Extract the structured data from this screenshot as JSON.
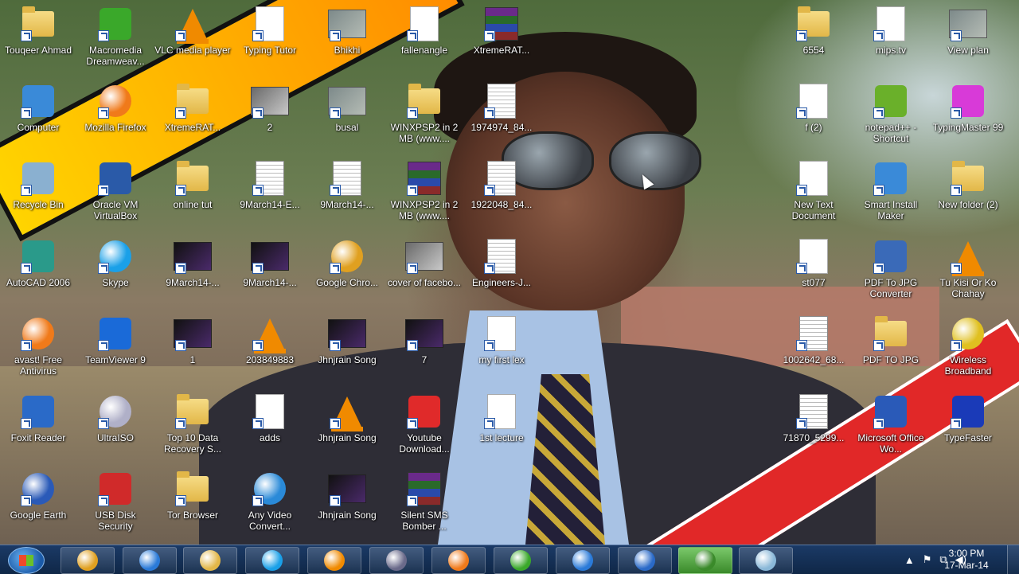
{
  "desktop": {
    "icons": [
      {
        "label": "Touqeer Ahmad",
        "icon": "user-folder-icon",
        "type": "folder",
        "x": 0,
        "y": 0
      },
      {
        "label": "Macromedia Dreamweav...",
        "icon": "dreamweaver-icon",
        "type": "app",
        "color": "#3aa82a"
      },
      {
        "label": "VLC media player",
        "icon": "vlc-icon",
        "type": "cone"
      },
      {
        "label": "Typing Tutor",
        "icon": "folder-icon",
        "type": "doc"
      },
      {
        "label": "Bhikhi",
        "icon": "image-thumbnail-icon",
        "type": "map"
      },
      {
        "label": "fallenangle",
        "icon": "html-file-icon",
        "type": "doc"
      },
      {
        "label": "XtremeRAT...",
        "icon": "winrar-icon",
        "type": "winrar"
      },
      {
        "label": "Computer",
        "icon": "computer-icon",
        "type": "app",
        "color": "#3a8ad8"
      },
      {
        "label": "Mozilla Firefox",
        "icon": "firefox-icon",
        "type": "round",
        "color": "#f07a1a"
      },
      {
        "label": "XtremeRAT...",
        "icon": "folder-icon",
        "type": "folder"
      },
      {
        "label": "2",
        "icon": "video-thumbnail-icon",
        "type": "thumb"
      },
      {
        "label": "busal",
        "icon": "image-thumbnail-icon",
        "type": "map"
      },
      {
        "label": "WINXPSP2 in 2 MB (www....",
        "icon": "folder-icon",
        "type": "folder"
      },
      {
        "label": "1974974_84...",
        "icon": "document-thumbnail-icon",
        "type": "docl"
      },
      {
        "label": "Recycle Bin",
        "icon": "recycle-bin-icon",
        "type": "app",
        "color": "#8ab0d0"
      },
      {
        "label": "Oracle VM VirtualBox",
        "icon": "virtualbox-icon",
        "type": "app",
        "color": "#2a5aa8"
      },
      {
        "label": "online tut",
        "icon": "folder-icon",
        "type": "folder"
      },
      {
        "label": "9March14-E...",
        "icon": "document-thumbnail-icon",
        "type": "docl"
      },
      {
        "label": "9March14-...",
        "icon": "document-thumbnail-icon",
        "type": "docl"
      },
      {
        "label": "WINXPSP2 in 2 MB (www....",
        "icon": "winrar-icon",
        "type": "winrar"
      },
      {
        "label": "1922048_84...",
        "icon": "document-thumbnail-icon",
        "type": "docl"
      },
      {
        "label": "AutoCAD 2006",
        "icon": "autocad-icon",
        "type": "app",
        "color": "#2a9a8a"
      },
      {
        "label": "Skype",
        "icon": "skype-icon",
        "type": "round",
        "color": "#1aa0e8"
      },
      {
        "label": "9March14-...",
        "icon": "document-thumbnail-icon",
        "type": "thumbdark"
      },
      {
        "label": "9March14-...",
        "icon": "document-thumbnail-icon",
        "type": "thumbdark"
      },
      {
        "label": "Google Chro...",
        "icon": "chrome-icon",
        "type": "round",
        "color": "#e0a020"
      },
      {
        "label": "cover of facebo...",
        "icon": "image-thumbnail-icon",
        "type": "thumb"
      },
      {
        "label": "Engineers-J...",
        "icon": "document-thumbnail-icon",
        "type": "docl"
      },
      {
        "label": "avast! Free Antivirus",
        "icon": "avast-icon",
        "type": "round",
        "color": "#f07a1a"
      },
      {
        "label": "TeamViewer 9",
        "icon": "teamviewer-icon",
        "type": "app",
        "color": "#1a6ad8"
      },
      {
        "label": "1",
        "icon": "video-thumbnail-icon",
        "type": "thumbdark"
      },
      {
        "label": "203849883",
        "icon": "vlc-icon",
        "type": "cone"
      },
      {
        "label": "Jhnjrain Song",
        "icon": "video-thumbnail-icon",
        "type": "thumbdark"
      },
      {
        "label": "7",
        "icon": "image-thumbnail-icon",
        "type": "thumbdark"
      },
      {
        "label": "my first lex",
        "icon": "firefox-html-icon",
        "type": "doc"
      },
      {
        "label": "Foxit Reader",
        "icon": "foxit-icon",
        "type": "app",
        "color": "#2a6ac8"
      },
      {
        "label": "UltraISO",
        "icon": "ultraiso-icon",
        "type": "round",
        "color": "#b0b0c8"
      },
      {
        "label": "Top 10 Data Recovery S...",
        "icon": "folder-icon",
        "type": "folder"
      },
      {
        "label": "adds",
        "icon": "blank-file-icon",
        "type": "doc"
      },
      {
        "label": "Jhnjrain Song",
        "icon": "vlc-icon",
        "type": "cone"
      },
      {
        "label": "Youtube Download...",
        "icon": "youtube-downloader-icon",
        "type": "app",
        "color": "#e02a2a"
      },
      {
        "label": "1st lecture",
        "icon": "firefox-html-icon",
        "type": "doc"
      },
      {
        "label": "Google Earth",
        "icon": "google-earth-icon",
        "type": "round",
        "color": "#2a5ab8"
      },
      {
        "label": "USB Disk Security",
        "icon": "usb-disk-security-icon",
        "type": "app",
        "color": "#d02a2a"
      },
      {
        "label": "Tor Browser",
        "icon": "folder-icon",
        "type": "folder"
      },
      {
        "label": "Any Video Convert...",
        "icon": "video-converter-icon",
        "type": "round",
        "color": "#2a8ad8"
      },
      {
        "label": "Jhnjrain Song",
        "icon": "video-thumbnail-icon",
        "type": "thumbdark"
      },
      {
        "label": "Silent SMS Bomber ...",
        "icon": "winrar-icon",
        "type": "winrar"
      },
      {
        "label": "6554",
        "icon": "folder-icon",
        "type": "folder"
      },
      {
        "label": "mips.tv",
        "icon": "blank-file-icon",
        "type": "doc"
      },
      {
        "label": "View plan",
        "icon": "image-thumbnail-icon",
        "type": "map"
      },
      {
        "label": "f (2)",
        "icon": "image-thumbnail-icon",
        "type": "doc"
      },
      {
        "label": "notepad++ - Shortcut",
        "icon": "notepadpp-icon",
        "type": "app",
        "color": "#6ab02a"
      },
      {
        "label": "TypingMaster 99",
        "icon": "typingmaster-icon",
        "type": "app",
        "color": "#d83ad8"
      },
      {
        "label": "New Text Document",
        "icon": "text-file-icon",
        "type": "doc"
      },
      {
        "label": "Smart Install Maker",
        "icon": "smart-install-icon",
        "type": "app",
        "color": "#3a8ad8"
      },
      {
        "label": "New folder (2)",
        "icon": "folder-icon",
        "type": "folder"
      },
      {
        "label": "st077",
        "icon": "blank-file-icon",
        "type": "doc"
      },
      {
        "label": "PDF To JPG Converter",
        "icon": "pdf-to-jpg-icon",
        "type": "app",
        "color": "#3a6ab8"
      },
      {
        "label": "Tu Kisi Or Ko Chahay",
        "icon": "vlc-icon",
        "type": "cone"
      },
      {
        "label": "1002642_68...",
        "icon": "spreadsheet-thumbnail-icon",
        "type": "docl"
      },
      {
        "label": "PDF TO JPG",
        "icon": "folder-icon",
        "type": "folder"
      },
      {
        "label": "Wireless Broadband",
        "icon": "worldcall-icon",
        "type": "round",
        "color": "#e0c020"
      },
      {
        "label": "71870_5299...",
        "icon": "document-thumbnail-icon",
        "type": "docl"
      },
      {
        "label": "Microsoft Office Wo...",
        "icon": "word-icon",
        "type": "app",
        "color": "#2a5ab8"
      },
      {
        "label": "TypeFaster",
        "icon": "typefaster-icon",
        "type": "app",
        "color": "#1a3ab8"
      }
    ]
  },
  "taskbar": {
    "start_label": "Start",
    "buttons": [
      {
        "name": "chrome",
        "icon": "chrome-icon",
        "color": "#e0a020"
      },
      {
        "name": "internet-explorer",
        "icon": "internet-explorer-icon",
        "color": "#2a7ad8"
      },
      {
        "name": "file-explorer",
        "icon": "folder-icon",
        "color": "#e2b748"
      },
      {
        "name": "skype",
        "icon": "skype-icon",
        "color": "#1aa0e8"
      },
      {
        "name": "vlc",
        "icon": "vlc-icon",
        "color": "#f08a00"
      },
      {
        "name": "media-player",
        "icon": "media-player-icon",
        "color": "#6a6a8a"
      },
      {
        "name": "firefox",
        "icon": "firefox-icon",
        "color": "#f07a1a"
      },
      {
        "name": "utorrent",
        "icon": "utorrent-icon",
        "color": "#3aa82a"
      },
      {
        "name": "internet-explorer-2",
        "icon": "internet-explorer-icon",
        "color": "#2a7ad8"
      },
      {
        "name": "foxit",
        "icon": "foxit-icon",
        "color": "#2a6ac8"
      },
      {
        "name": "camtasia",
        "icon": "camtasia-icon",
        "color": "#3a8a2a",
        "active": true
      },
      {
        "name": "notepad",
        "icon": "notepad-icon",
        "color": "#8ab8d8"
      }
    ],
    "tray": {
      "show_hidden": "▲",
      "flag": "⚑",
      "network": "⧉",
      "volume": "◀)"
    },
    "clock": {
      "time": "3:00 PM",
      "date": "17-Mar-14"
    }
  }
}
